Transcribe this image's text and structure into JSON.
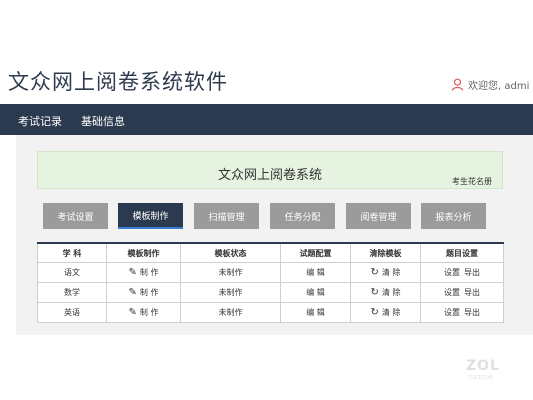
{
  "header": {
    "app_title": "文众网上阅卷系统软件",
    "user_text": "欢迎您, admi"
  },
  "nav": {
    "items": [
      {
        "label": "考试记录"
      },
      {
        "label": "基础信息"
      }
    ]
  },
  "banner": {
    "title": "文众网上阅卷系统",
    "link": "考生花名册"
  },
  "tabs": [
    {
      "label": "考试设置",
      "active": false
    },
    {
      "label": "模板制作",
      "active": true
    },
    {
      "label": "扫描管理",
      "active": false
    },
    {
      "label": "任务分配",
      "active": false
    },
    {
      "label": "阅卷管理",
      "active": false
    },
    {
      "label": "报表分析",
      "active": false
    }
  ],
  "table": {
    "columns": [
      "学 科",
      "模板制作",
      "模板状态",
      "试题配置",
      "清除模板",
      "题目设置"
    ],
    "rows": [
      {
        "subject": "语文",
        "make": "制 作",
        "status": "未制作",
        "config": "编 辑",
        "clear": "清 除",
        "setting": "设置",
        "export": "导出"
      },
      {
        "subject": "数学",
        "make": "制 作",
        "status": "未制作",
        "config": "编 辑",
        "clear": "清 除",
        "setting": "设置",
        "export": "导出"
      },
      {
        "subject": "英语",
        "make": "制 作",
        "status": "未制作",
        "config": "编 辑",
        "clear": "清 除",
        "setting": "设置",
        "export": "导出"
      }
    ]
  },
  "icons": {
    "user": "user-icon",
    "edit": "edit-icon",
    "refresh": "refresh-icon"
  },
  "colors": {
    "navbar": "#2c3a4f",
    "tab_inactive": "#9b9b9b",
    "tab_active": "#2c3a4f",
    "banner_bg": "#e7f3e1",
    "content_bg": "#f2f2f2",
    "user_icon": "#e05a5a"
  },
  "watermark": {
    "text": "ZOL",
    "sub": "中关村在线"
  }
}
